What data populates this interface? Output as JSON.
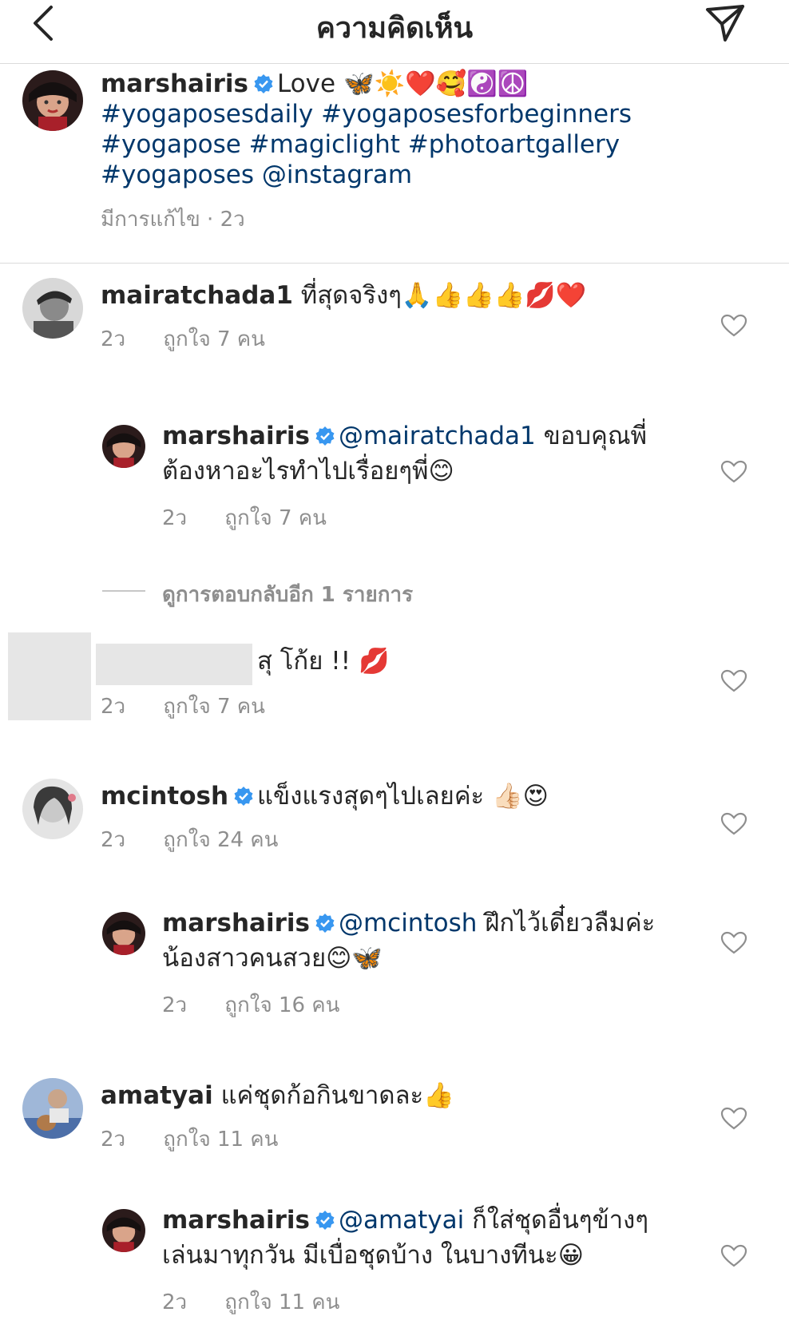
{
  "header": {
    "title": "ความคิดเห็น",
    "back_icon": "chevron-left-icon",
    "share_icon": "paper-plane-icon"
  },
  "caption": {
    "username": "marshairis",
    "text": "Love",
    "emojis": "🦋☀️❤️🥰☯️☮️",
    "hashtags_line1": "#yogaposesdaily #yogaposesforbeginners",
    "hashtags_line2": "#yogapose #magiclight  #photoartgallery",
    "hashtags_line3": "#yogaposes @instagram",
    "meta": "มีการแก้ไข · 2ว"
  },
  "comments": [
    {
      "username": "mairatchada1",
      "text": "ที่สุดจริงๆ",
      "emojis": "🙏👍👍👍💋❤️",
      "time": "2ว",
      "likes": "ถูกใจ 7 คน"
    },
    {
      "username": "marshairis",
      "mention": "@mairatchada1",
      "text": "ขอบคุณพี่ ต้องหาอะไรทำไปเรื่อยๆพี่",
      "emojis": "😊",
      "time": "2ว",
      "likes": "ถูกใจ 7 คน"
    },
    {
      "username": "",
      "text": "สุ โก้ย !!",
      "emojis": "💋",
      "time": "2ว",
      "likes": "ถูกใจ 7 คน"
    },
    {
      "username": "mcintosh",
      "text": "แข็งแรงสุดๆไปเลยค่ะ",
      "emojis": "👍🏻😍",
      "time": "2ว",
      "likes": "ถูกใจ 24 คน"
    },
    {
      "username": "marshairis",
      "mention": "@mcintosh",
      "text": "ฝึกไว้เดี๋ยวลืมค่ะ น้องสาวคนสวย",
      "emojis": "😊🦋",
      "time": "2ว",
      "likes": "ถูกใจ 16 คน"
    },
    {
      "username": "amatyai",
      "text": "แค่ชุดก้อกินขาดละ",
      "emojis": "👍",
      "time": "2ว",
      "likes": "ถูกใจ 11 คน"
    },
    {
      "username": "marshairis",
      "mention": "@amatyai",
      "text": "ก็ใส่ชุดอื่นๆข้างๆ เล่นมาทุกวัน มีเบื่อชุดบ้าง ในบางทีนะ",
      "emojis": "😀",
      "time": "2ว",
      "likes": "ถูกใจ 11 คน"
    }
  ],
  "view_replies": "ดูการตอบกลับอีก 1 รายการ",
  "colors": {
    "link": "#00376b",
    "muted": "#8e8e8e",
    "verified": "#3897f0",
    "divider": "#dbdbdb"
  }
}
